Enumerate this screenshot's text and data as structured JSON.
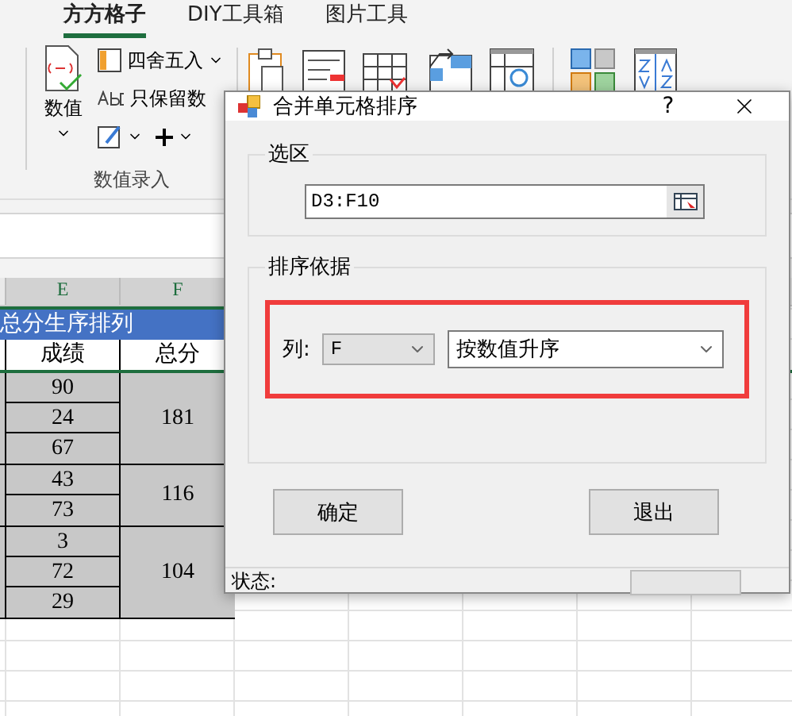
{
  "ribbon": {
    "tabs": [
      {
        "label": "方方格子",
        "selected": true
      },
      {
        "label": "DIY工具箱",
        "selected": false
      },
      {
        "label": "图片工具",
        "selected": false
      }
    ],
    "group": {
      "label": "数值录入",
      "big_button": "数值",
      "round_button": "四舍五入",
      "keep_values_button": "只保留数"
    }
  },
  "sheet": {
    "columns": [
      "E",
      "F"
    ],
    "title": "总分生序排列",
    "headers": [
      "成绩",
      "总分"
    ],
    "groups": [
      {
        "total": "181",
        "scores": [
          "90",
          "24",
          "67"
        ]
      },
      {
        "total": "116",
        "scores": [
          "43",
          "73"
        ]
      },
      {
        "total": "104",
        "scores": [
          "3",
          "72",
          "29"
        ]
      }
    ]
  },
  "dialog": {
    "title": "合并单元格排序",
    "help": "?",
    "selection": {
      "legend": "选区",
      "value": "D3:F10"
    },
    "sort": {
      "legend": "排序依据",
      "column_label": "列:",
      "column_value": "F",
      "order_value": "按数值升序"
    },
    "buttons": [
      "确定",
      "退出"
    ],
    "status_label": "状态:"
  }
}
